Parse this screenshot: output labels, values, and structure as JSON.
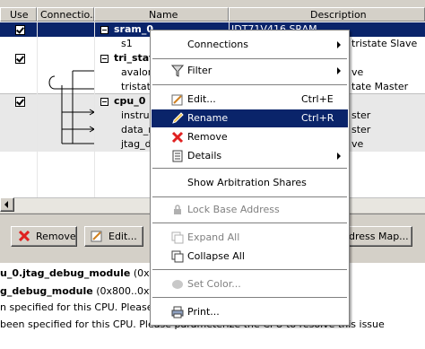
{
  "table": {
    "columns": [
      "Use",
      "Connectio...",
      "Name",
      "Description"
    ],
    "rows": [
      {
        "name": "sram_0",
        "desc": "IDT71V416 SRAM"
      },
      {
        "name": "s1",
        "desc": "tristate Slave"
      },
      {
        "name": "tri_stat",
        "desc": ""
      },
      {
        "name": "avalon",
        "desc": "ve"
      },
      {
        "name": "tristate",
        "desc": "tate Master"
      },
      {
        "name": "cpu_0",
        "desc": ""
      },
      {
        "name": "instruc",
        "desc": "ster"
      },
      {
        "name": "data_m",
        "desc": "ster"
      },
      {
        "name": "jtag_de",
        "desc": "ve"
      }
    ]
  },
  "buttons": {
    "remove": "Remove",
    "edit": "Edit...",
    "address_map": "ddress Map..."
  },
  "messages": {
    "line1_bold": "u_0.jtag_debug_module",
    "line1_rest": " (0x800",
    "line2_bold": "g_debug_module",
    "line2_rest": " (0x800..0xfff)",
    "line3": "n specified for this CPU. Please par",
    "line4": "been specified for this CPU. Please parameterize the CPU to resolve this issue"
  },
  "menu": {
    "connections": "Connections",
    "filter": "Filter",
    "edit": "Edit...",
    "edit_shortcut": "Ctrl+E",
    "rename": "Rename",
    "rename_shortcut": "Ctrl+R",
    "remove": "Remove",
    "details": "Details",
    "show_arbitration": "Show Arbitration Shares",
    "lock_base": "Lock Base Address",
    "expand_all": "Expand All",
    "collapse_all": "Collapse All",
    "set_color": "Set Color...",
    "print": "Print..."
  },
  "colors": {
    "selection": "#0a246a",
    "remove_icon": "#e02020"
  }
}
